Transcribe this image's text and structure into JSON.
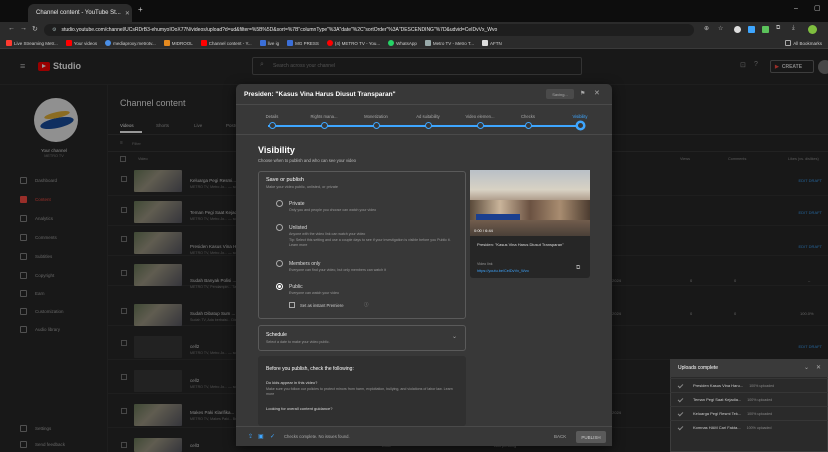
{
  "browser": {
    "tab_title": "Channel content - YouTube St...",
    "url": "studio.youtube.com/channel/UCsRDrB3-ehumyoIOoX77N/videos/upload?d=ud&filter=%5B%5D&sort=%7B\"columnType\"%3A\"date\"%2C\"sortOrder\"%3A\"DESCENDING\"%7D&udvid=CeIDvVx_Wvo",
    "bookmarks": [
      "Live Streaming Metr...",
      "Your videos",
      "mediaproxy.metrotv...",
      "MIDROOL",
      "Channel content - Y...",
      "live ig",
      "MG PRESS",
      "(4) METRO TV - You...",
      "WhatsApp",
      "Metro TV - Metro T...",
      "AFTN"
    ],
    "bookmarks_right": "All Bookmarks"
  },
  "studio": {
    "logo": "Studio",
    "search_placeholder": "Search across your channel",
    "create_label": "CREATE"
  },
  "sidebar": {
    "channel_label": "Your channel",
    "channel_name": "METRO TV",
    "items": [
      "Dashboard",
      "Content",
      "Analytics",
      "Comments",
      "Subtitles",
      "Copyright",
      "Earn",
      "Customization",
      "Audio library"
    ],
    "bottom": [
      "Settings",
      "Send feedback"
    ]
  },
  "content": {
    "title": "Channel content",
    "tabs": [
      "Videos",
      "Shorts",
      "Live",
      "Posts"
    ],
    "filter": "Filter",
    "col_video": "Video",
    "cols_right": [
      "Views",
      "Comments",
      "Likes (vs. dislikes)"
    ],
    "rows": [
      {
        "title": "Keluarga Pegi Resmi...",
        "sub": "METRO TV, Metro Jo... — scanned both Ulosh mi...",
        "status": "EDIT DRAFT",
        "date": "",
        "views": "",
        "comments": "",
        "likes": ""
      },
      {
        "title": "Teman Pegi Saat Kejadi...",
        "sub": "METRO TV, Metro Jo... — scanned both Ulosh mi...",
        "status": "EDIT DRAFT",
        "date": "",
        "views": "",
        "comments": "",
        "likes": ""
      },
      {
        "title": "Presiden Kasus Vina Ha...",
        "sub": "METRO TV, Metro Jo... — scanned both Ulosh mi...",
        "status": "EDIT DRAFT",
        "date": "",
        "views": "",
        "comments": "",
        "likes": ""
      },
      {
        "title": "Sudah Banyak Polisi ...",
        "sub": "METRO TV, Pendampin... Tanim Dijanahkan Fo...",
        "status": "",
        "date": "2024",
        "views": "0",
        "comments": "0",
        "likes": "–"
      },
      {
        "title": "Sudah Dibatup Sum ...",
        "sub": "Sudah TV, Ada berbaisi... Dia hali ke Tentaria Vi...",
        "status": "",
        "date": "2024",
        "views": "0",
        "comments": "0",
        "likes": "100.0%"
      },
      {
        "title": "cell2",
        "sub": "METRO TV, Metro Jo... — scanned both Ulosh mi...",
        "status": "EDIT DRAFT",
        "date": "",
        "views": "",
        "comments": "",
        "likes": ""
      },
      {
        "title": "cell2",
        "sub": "METRO TV, Metro Jo... — scanned both Ulosh mi...",
        "status": "",
        "date": "",
        "views": "",
        "comments": "",
        "likes": ""
      },
      {
        "title": "Makes Paki Klarifika...",
        "sub": "METRO TV, Makes Paki... Bertanding Masuk Ha...",
        "status": "",
        "date": "2024",
        "views": "",
        "comments": "",
        "likes": ""
      },
      {
        "title": "cell3",
        "sub": "",
        "status": "",
        "date": "Draft",
        "views": "Ads pending",
        "comments": "",
        "likes": ""
      }
    ]
  },
  "dialog": {
    "title": "Presiden: \"Kasus Vina Harus Diusut Transparan\"",
    "saving_label": "Saving...",
    "steps": [
      "Details",
      "Rights mana...",
      "Monetization",
      "Ad suitability",
      "Video elemen...",
      "Checks",
      "Visibility"
    ],
    "heading": "Visibility",
    "subheading": "Choose when to publish and who can see your video",
    "save_title": "Save or publish",
    "save_sub": "Make your video public, unlisted, or private",
    "options": [
      {
        "label": "Private",
        "desc": "Only you and people you choose can watch your video"
      },
      {
        "label": "Unlisted",
        "desc": "Anyone with the video link can watch your video"
      },
      {
        "label": "Members only",
        "desc": "Everyone can find your video, but only members can watch it"
      },
      {
        "label": "Public",
        "desc": "Everyone can watch your video"
      }
    ],
    "unlisted_tip": "Tip: Select this setting and use a couple days to see if your investigation is visible before you Public it. Learn more",
    "instant_premiere": "Set as instant Premiere",
    "schedule_title": "Schedule",
    "schedule_sub": "Select a date to make your video public.",
    "before_title": "Before you publish, check the following:",
    "q1": "Do kids appear in this video?",
    "q1_desc": "Make sure you follow our policies to protect minors from harm, exploitation, bullying, and violations of labor law. Learn more",
    "q2": "Looking for overall content guidance?",
    "footer_status": "Checks complete. No issues found.",
    "back_label": "BACK",
    "publish_label": "PUBLISH",
    "preview_title": "Presiden: \"Kasus Vina Harus Diusut Transparan\"",
    "preview_link_label": "Video link",
    "preview_link": "https://youtu.be/CeIDvVx_Wvo",
    "preview_time": "0:00 / 6:44"
  },
  "uploads": {
    "title": "Uploads complete",
    "items": [
      {
        "name": "Presiden Kasus Vina Haru...",
        "status": "100% uploaded"
      },
      {
        "name": "Teman Pegi Saat Kejadia...",
        "status": "100% uploaded"
      },
      {
        "name": "Keluarga Pegi Resmi Tek...",
        "status": "100% uploaded"
      },
      {
        "name": "Komnas HAM Cari Fakta...",
        "status": "100% uploaded"
      }
    ]
  },
  "colors": {
    "accent": "#3ea6ff",
    "brand": "#ff0000"
  }
}
